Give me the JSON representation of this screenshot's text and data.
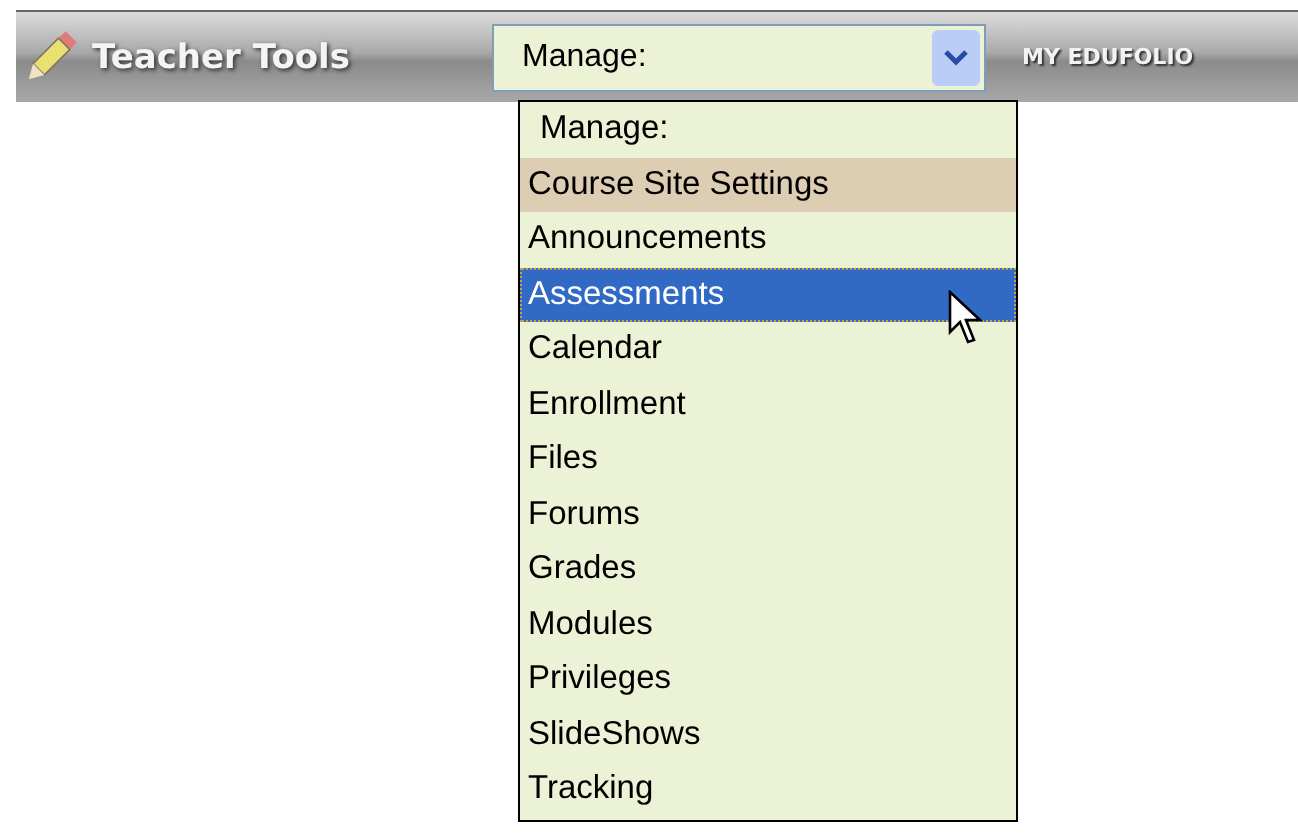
{
  "toolbar": {
    "title": "Teacher Tools",
    "next_tab": "MY EDUFOLIO"
  },
  "select": {
    "value": "Manage:",
    "expanded": true
  },
  "options": [
    {
      "label": "Manage:",
      "kind": "heading",
      "selected": false
    },
    {
      "label": "Course Site Settings",
      "kind": "shaded",
      "selected": false
    },
    {
      "label": "Announcements",
      "kind": "option",
      "selected": false
    },
    {
      "label": "Assessments",
      "kind": "option",
      "selected": true
    },
    {
      "label": "Calendar",
      "kind": "option",
      "selected": false
    },
    {
      "label": "Enrollment",
      "kind": "option",
      "selected": false
    },
    {
      "label": "Files",
      "kind": "option",
      "selected": false
    },
    {
      "label": "Forums",
      "kind": "option",
      "selected": false
    },
    {
      "label": "Grades",
      "kind": "option",
      "selected": false
    },
    {
      "label": "Modules",
      "kind": "option",
      "selected": false
    },
    {
      "label": "Privileges",
      "kind": "option",
      "selected": false
    },
    {
      "label": "SlideShows",
      "kind": "option",
      "selected": false
    },
    {
      "label": "Tracking",
      "kind": "option",
      "selected": false
    }
  ]
}
